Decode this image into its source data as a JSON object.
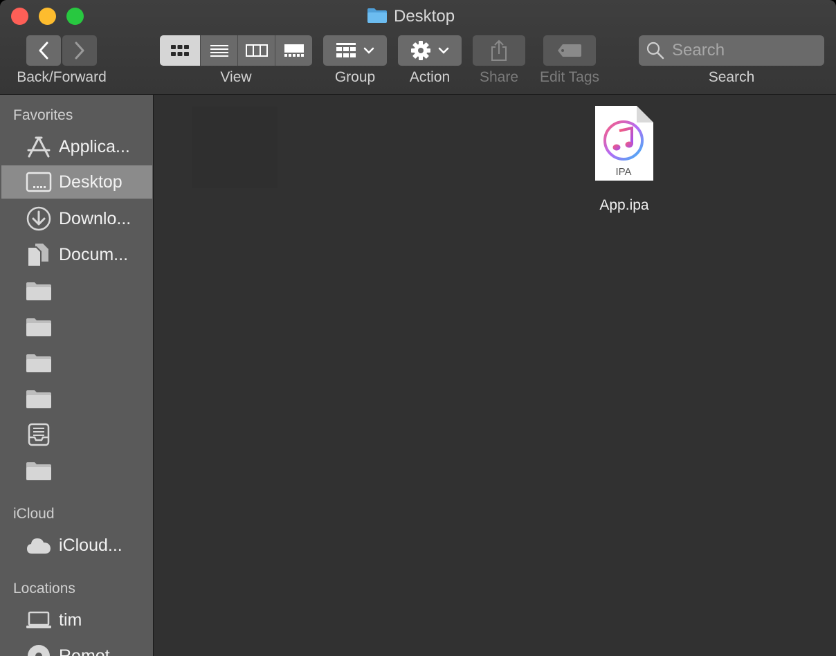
{
  "window": {
    "title": "Desktop",
    "title_icon": "folder-icon"
  },
  "toolbar": {
    "back_forward_label": "Back/Forward",
    "view_label": "View",
    "group_label": "Group",
    "action_label": "Action",
    "share_label": "Share",
    "edit_tags_label": "Edit Tags",
    "search_label": "Search",
    "search_placeholder": "Search",
    "view_modes": [
      "icon-view",
      "list-view",
      "column-view",
      "gallery-view"
    ],
    "selected_view": "icon-view"
  },
  "sidebar": {
    "favorites_heading": "Favorites",
    "favorites": [
      {
        "label": "Applica...",
        "icon": "applications-icon"
      },
      {
        "label": "Desktop",
        "icon": "desktop-icon",
        "selected": true
      },
      {
        "label": "Downlo...",
        "icon": "downloads-icon"
      },
      {
        "label": "Docum...",
        "icon": "documents-icon"
      },
      {
        "label": "",
        "icon": "folder-icon"
      },
      {
        "label": "",
        "icon": "folder-icon"
      },
      {
        "label": "",
        "icon": "folder-icon"
      },
      {
        "label": "",
        "icon": "folder-icon"
      },
      {
        "label": "",
        "icon": "inbox-icon"
      },
      {
        "label": "",
        "icon": "folder-icon"
      }
    ],
    "icloud_heading": "iCloud",
    "icloud": [
      {
        "label": "iCloud...",
        "icon": "cloud-icon"
      }
    ],
    "locations_heading": "Locations",
    "locations": [
      {
        "label": "tim",
        "icon": "laptop-icon"
      },
      {
        "label": "Remot...",
        "icon": "disc-icon"
      }
    ]
  },
  "content": {
    "files": [
      {
        "name": "App.ipa",
        "badge": "IPA",
        "icon": "ipa-file-icon"
      }
    ]
  },
  "colors": {
    "window_bg": "#313131",
    "sidebar_bg": "#5a5a5a",
    "sidebar_selected": "#8b8b8b",
    "folder_accent": "#5ab0e6"
  }
}
